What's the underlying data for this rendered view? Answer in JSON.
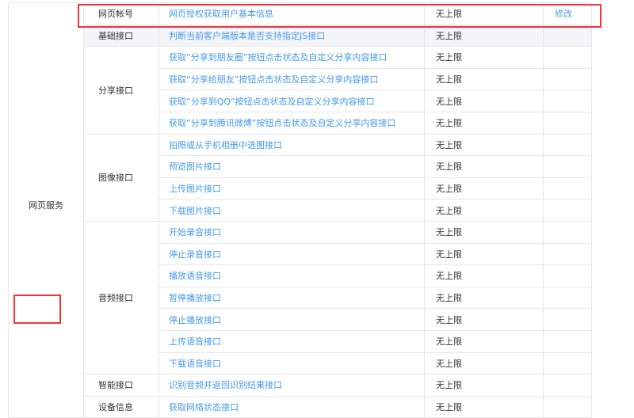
{
  "category": "网页服务",
  "rows": [
    {
      "group": "网页帐号",
      "api": "网页授权获取用户基本信息",
      "limit": "无上限",
      "action": "修改"
    },
    {
      "group": "基础接口",
      "api": "判断当前客户端版本是否支持指定JS接口",
      "limit": "无上限"
    },
    {
      "group": "分享接口",
      "api": "获取“分享到朋友圈”按钮点击状态及自定义分享内容接口",
      "limit": "无上限"
    },
    {
      "api": "获取“分享给朋友”按钮点击状态及自定义分享内容接口",
      "limit": "无上限"
    },
    {
      "api": "获取“分享到QQ”按钮点击状态及自定义分享内容接口",
      "limit": "无上限"
    },
    {
      "api": "获取“分享到腾讯微博”按钮点击状态及自定义分享内容接口",
      "limit": "无上限"
    },
    {
      "group": "图像接口",
      "api": "拍照或从手机相册中选图接口",
      "limit": "无上限"
    },
    {
      "api": "预览图片接口",
      "limit": "无上限"
    },
    {
      "api": "上传图片接口",
      "limit": "无上限"
    },
    {
      "api": "下载图片接口",
      "limit": "无上限"
    },
    {
      "group": "音频接口",
      "api": "开始录音接口",
      "limit": "无上限"
    },
    {
      "api": "停止录音接口",
      "limit": "无上限"
    },
    {
      "api": "播放语音接口",
      "limit": "无上限"
    },
    {
      "api": "暂停播放接口",
      "limit": "无上限"
    },
    {
      "api": "停止播放接口",
      "limit": "无上限"
    },
    {
      "api": "上传语音接口",
      "limit": "无上限"
    },
    {
      "api": "下载语音接口",
      "limit": "无上限"
    },
    {
      "group": "智能接口",
      "api": "识别音频并返回识别结果接口",
      "limit": "无上限"
    },
    {
      "group": "设备信息",
      "api": "获取网络状态接口",
      "limit": "无上限"
    }
  ]
}
